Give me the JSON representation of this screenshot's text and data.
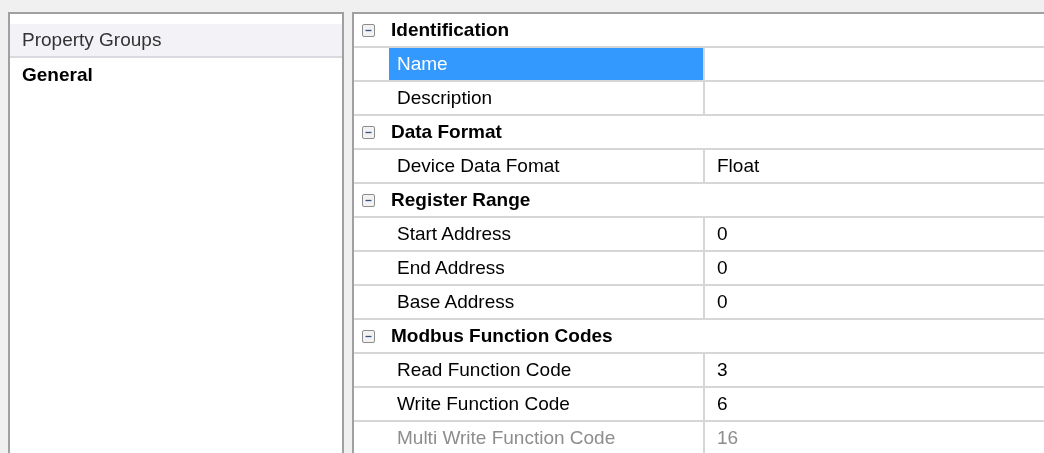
{
  "property_groups": {
    "header": "Property Groups",
    "items": [
      {
        "label": "General",
        "selected": true
      }
    ]
  },
  "property_grid": {
    "categories": [
      {
        "title": "Identification",
        "expanded": true,
        "properties": [
          {
            "name": "Name",
            "selected": true,
            "disabled": false
          },
          {
            "name": "Description",
            "selected": false,
            "disabled": false
          }
        ]
      },
      {
        "title": "Data Format",
        "expanded": true,
        "properties": [
          {
            "name": "Device Data Fomat",
            "value": "Float",
            "selected": false,
            "disabled": false
          }
        ]
      },
      {
        "title": "Register Range",
        "expanded": true,
        "properties": [
          {
            "name": "Start Address",
            "value": "0",
            "selected": false,
            "disabled": false
          },
          {
            "name": "End Address",
            "value": "0",
            "selected": false,
            "disabled": false
          },
          {
            "name": "Base Address",
            "value": "0",
            "selected": false,
            "disabled": false
          }
        ]
      },
      {
        "title": "Modbus Function Codes",
        "expanded": true,
        "properties": [
          {
            "name": "Read Function Code",
            "value": "3",
            "selected": false,
            "disabled": false
          },
          {
            "name": "Write Function Code",
            "value": "6",
            "selected": false,
            "disabled": false
          },
          {
            "name": "Multi Write Function Code",
            "value": "16",
            "selected": false,
            "disabled": true
          }
        ]
      }
    ]
  }
}
